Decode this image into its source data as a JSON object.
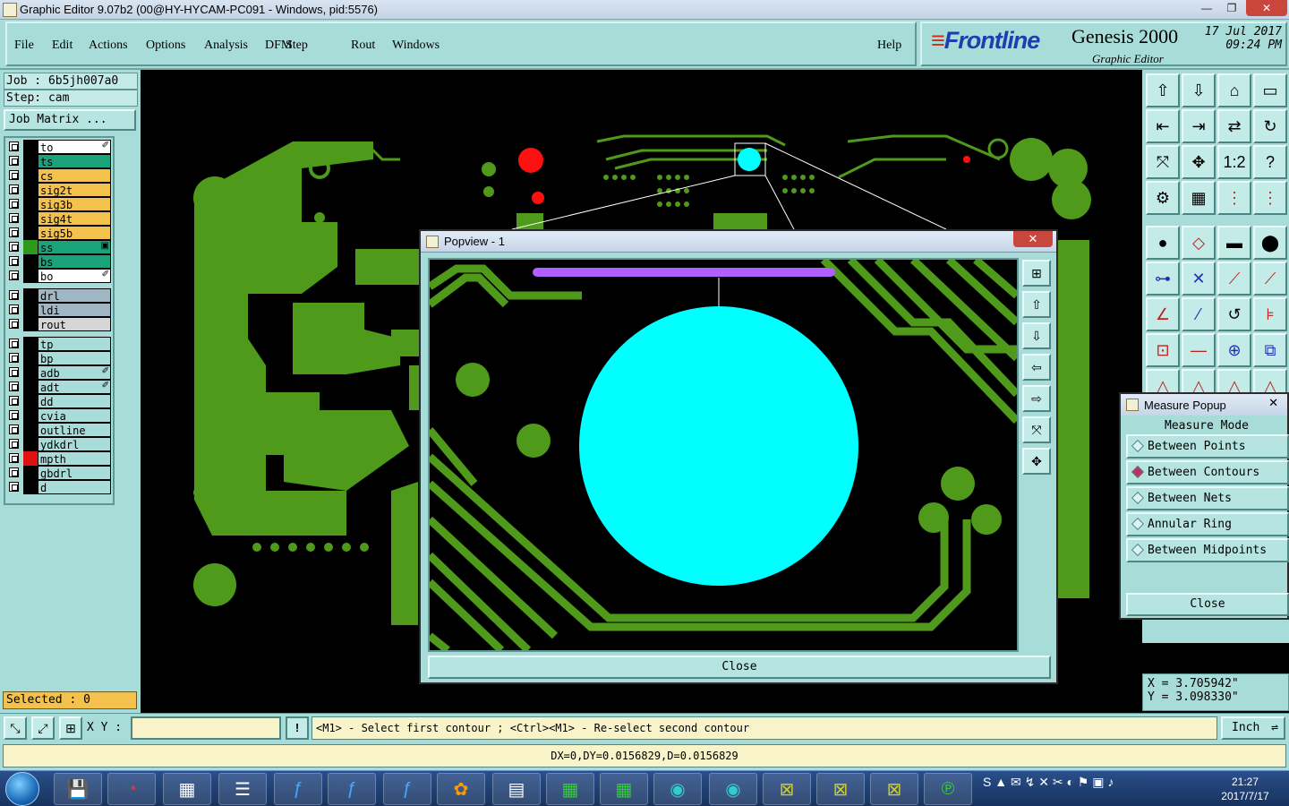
{
  "window": {
    "title": "Graphic Editor 9.07b2 (00@HY-HYCAM-PC091 - Windows, pid:5576)",
    "minimize": "—",
    "restore": "❐",
    "close": "✕"
  },
  "menu": {
    "file": "File",
    "edit": "Edit",
    "actions": "Actions",
    "options": "Options",
    "analysis": "Analysis",
    "dfm": "DFM",
    "step": "Step",
    "rout": "Rout",
    "windows": "Windows",
    "help": "Help"
  },
  "brand": {
    "logo": "Frontline",
    "product": "Genesis 2000",
    "subtitle": "Graphic Editor",
    "date": "17 Jul 2017",
    "time": "09:24 PM"
  },
  "left": {
    "job": "Job : 6b5jh007a0",
    "step": "Step: cam",
    "job_matrix": "Job Matrix ..."
  },
  "layers": [
    {
      "name": "to",
      "bg": "#ffffff",
      "swatch": "#000000",
      "mark": "✐"
    },
    {
      "name": "ts",
      "bg": "#1aa37a",
      "swatch": "#000000",
      "mark": ""
    },
    {
      "name": "cs",
      "bg": "#f4c14d",
      "swatch": "#000000",
      "mark": ""
    },
    {
      "name": "sig2t",
      "bg": "#f4c14d",
      "swatch": "#000000",
      "mark": ""
    },
    {
      "name": "sig3b",
      "bg": "#f4c14d",
      "swatch": "#000000",
      "mark": ""
    },
    {
      "name": "sig4t",
      "bg": "#f4c14d",
      "swatch": "#000000",
      "mark": ""
    },
    {
      "name": "sig5b",
      "bg": "#f4c14d",
      "swatch": "#000000",
      "mark": ""
    },
    {
      "name": "ss",
      "bg": "#1aa37a",
      "swatch": "#2f9a1a",
      "mark": "▣"
    },
    {
      "name": "bs",
      "bg": "#1aa37a",
      "swatch": "#000000",
      "mark": ""
    },
    {
      "name": "bo",
      "bg": "#ffffff",
      "swatch": "#000000",
      "mark": "✐"
    },
    {
      "name": "drl",
      "bg": "#9fb6c4",
      "swatch": "#000000",
      "mark": ""
    },
    {
      "name": "ldi",
      "bg": "#9fb6c4",
      "swatch": "#000000",
      "mark": ""
    },
    {
      "name": "rout",
      "bg": "#d6d6d6",
      "swatch": "#000000",
      "mark": ""
    },
    {
      "name": "tp",
      "bg": "#a8dcd8",
      "swatch": "#000000",
      "mark": ""
    },
    {
      "name": "bp",
      "bg": "#a8dcd8",
      "swatch": "#000000",
      "mark": ""
    },
    {
      "name": "adb",
      "bg": "#a8dcd8",
      "swatch": "#000000",
      "mark": "✐"
    },
    {
      "name": "adt",
      "bg": "#a8dcd8",
      "swatch": "#000000",
      "mark": "✐"
    },
    {
      "name": "dd",
      "bg": "#a8dcd8",
      "swatch": "#000000",
      "mark": ""
    },
    {
      "name": "cvia",
      "bg": "#a8dcd8",
      "swatch": "#000000",
      "mark": ""
    },
    {
      "name": "outline",
      "bg": "#a8dcd8",
      "swatch": "#000000",
      "mark": ""
    },
    {
      "name": "ydkdrl",
      "bg": "#a8dcd8",
      "swatch": "#000000",
      "mark": ""
    },
    {
      "name": "mpth",
      "bg": "#a8dcd8",
      "swatch": "#e01010",
      "mark": ""
    },
    {
      "name": "gbdrl",
      "bg": "#a8dcd8",
      "swatch": "#000000",
      "mark": ""
    },
    {
      "name": "d",
      "bg": "#a8dcd8",
      "swatch": "#000000",
      "mark": ""
    }
  ],
  "selected": "Selected : 0",
  "popview": {
    "title": "Popview - 1",
    "close_x": "✕",
    "close_label": "Close"
  },
  "measure": {
    "title": "Measure Popup",
    "close_x": "✕",
    "mode_label": "Measure Mode",
    "options": [
      "Between Points",
      "Between Contours",
      "Between Nets",
      "Annular Ring",
      "Between Midpoints"
    ],
    "selected_option": "Between Contours",
    "close_label": "Close"
  },
  "coords": {
    "x": "X = 3.705942\"",
    "y": "Y = 3.098330\""
  },
  "bottom": {
    "xy_label": "X Y :",
    "xy_value": "",
    "warn": "!",
    "prompt": "<M1> - Select first contour ; <Ctrl><M1> - Re-select second contour",
    "units": "Inch"
  },
  "status": "DX=0,DY=0.0156829,D=0.0156829",
  "clock": {
    "time": "21:27",
    "date": "2017/7/17"
  },
  "colors": {
    "copper": "#4f9a1a",
    "pad_cyan": "#00ffff",
    "purple_trace": "#b060ff",
    "red_pad": "#ff1010",
    "panel": "#a8dcd8"
  }
}
